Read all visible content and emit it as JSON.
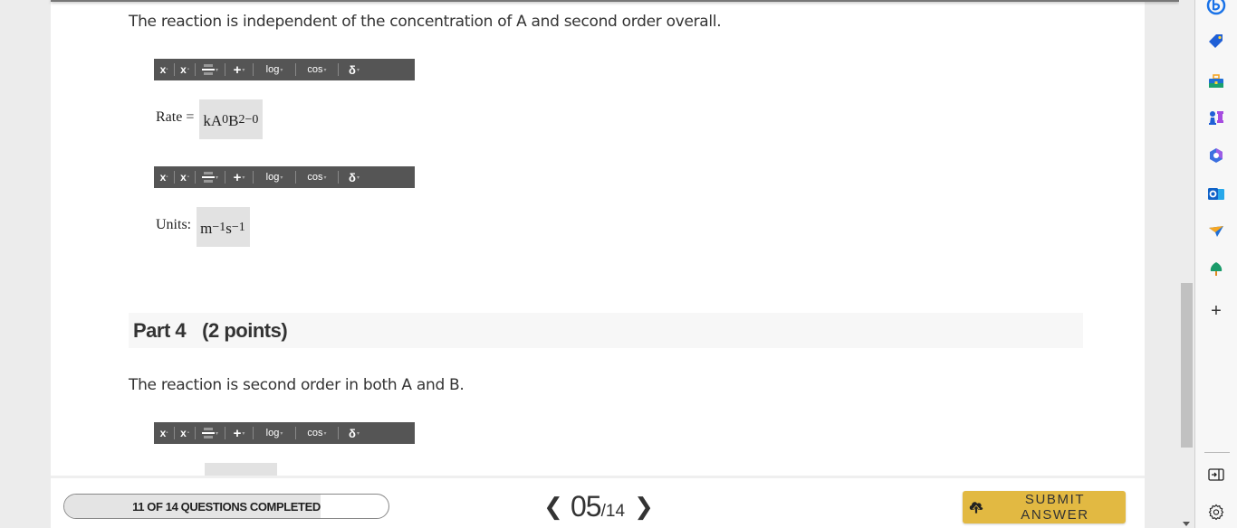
{
  "question": {
    "part3_prompt": "The reaction is independent of the concentration of A and second order overall.",
    "rate_label": "Rate =",
    "rate_answer": {
      "base1": "kA",
      "exp1": "0",
      "base2": "B",
      "exp2": "2−0"
    },
    "units_label": "Units:",
    "units_answer": {
      "base1": "m",
      "exp1": "−1",
      "base2": "s",
      "exp2": "−1"
    },
    "part4_title": "Part 4",
    "part4_points": "(2 points)",
    "part4_prompt": "The reaction is second order in both A and B."
  },
  "math_toolbar": {
    "buttons": [
      {
        "name": "superscript",
        "label": "x"
      },
      {
        "name": "subscript",
        "label": "x"
      },
      {
        "name": "fraction",
        "label": ""
      },
      {
        "name": "operators",
        "label": "+"
      },
      {
        "name": "log",
        "label": "log"
      },
      {
        "name": "trig",
        "label": "cos"
      },
      {
        "name": "greek",
        "label": "δ"
      }
    ]
  },
  "footer": {
    "progress_label": "11 OF 14 QUESTIONS COMPLETED",
    "progress_completed": 11,
    "progress_total": 14,
    "progress_fraction": 0.79,
    "current_page": "05",
    "total_pages": "/14",
    "prev_arrow": "❮",
    "next_arrow": "❯",
    "submit_label": "SUBMIT ANSWER"
  },
  "sidebar": {
    "icons": [
      "bing-chat-icon",
      "shopping-tag-icon",
      "toolbox-icon",
      "games-icon",
      "microsoft365-icon",
      "outlook-icon",
      "send-icon",
      "tree-icon",
      "add-icon",
      "hide-sidebar-icon",
      "settings-icon"
    ],
    "add_label": "+"
  },
  "colors": {
    "submit_button": "#e2b942",
    "toolbar_bg": "#555555",
    "answer_box_bg": "#e2e2e2",
    "progress_fill": "#e4e4e4"
  }
}
